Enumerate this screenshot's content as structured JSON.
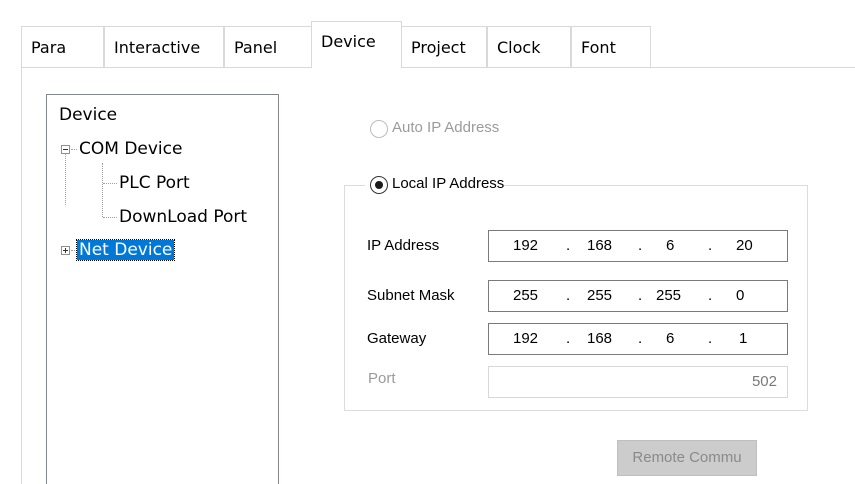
{
  "tabs": [
    {
      "label": "Para"
    },
    {
      "label": "Interactive"
    },
    {
      "label": "Panel"
    },
    {
      "label": "Device",
      "active": true
    },
    {
      "label": "Project"
    },
    {
      "label": "Clock"
    },
    {
      "label": "Font"
    }
  ],
  "tree": {
    "root": "Device",
    "com_device": "COM Device",
    "plc_port": "PLC Port",
    "download_port": "DownLoad Port",
    "net_device": "Net Device",
    "selected": "Net Device"
  },
  "network": {
    "auto_ip_label": "Auto IP Address",
    "auto_ip_enabled": false,
    "local_ip_label": "Local IP Address",
    "local_ip_selected": true,
    "ip_address": {
      "label": "IP Address",
      "octets": [
        "192",
        "168",
        "6",
        "20"
      ]
    },
    "subnet_mask": {
      "label": "Subnet Mask",
      "octets": [
        "255",
        "255",
        "255",
        "0"
      ]
    },
    "gateway": {
      "label": "Gateway",
      "octets": [
        "192",
        "168",
        "6",
        "1"
      ]
    },
    "port": {
      "label": "Port",
      "value": "502",
      "enabled": false
    },
    "separator": "."
  },
  "buttons": {
    "remote_commu": "Remote Commu"
  },
  "colors": {
    "selection": "#0078d7",
    "disabled_text": "#9b9b9b",
    "disabled_button": "#cccccc"
  }
}
